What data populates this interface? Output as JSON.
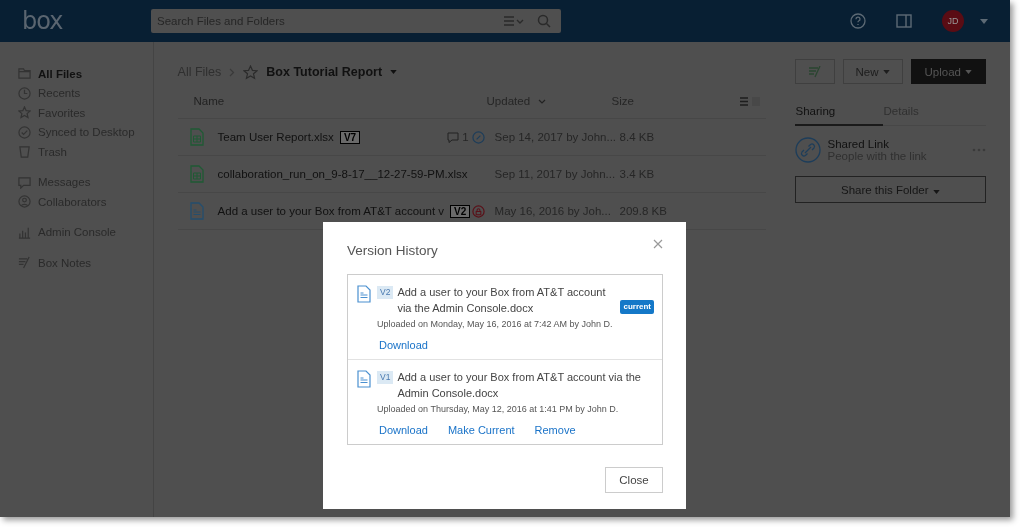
{
  "header": {
    "logo": "box",
    "search": {
      "placeholder": "Search Files and Folders"
    },
    "avatar": "JD"
  },
  "sidebar": {
    "groups": [
      [
        {
          "label": "All Files",
          "kind": "folder",
          "selected": true
        },
        {
          "label": "Recents",
          "kind": "clock",
          "selected": false
        },
        {
          "label": "Favorites",
          "kind": "star",
          "selected": false
        },
        {
          "label": "Synced to Desktop",
          "kind": "check",
          "selected": false
        },
        {
          "label": "Trash",
          "kind": "trash",
          "selected": false
        }
      ],
      [
        {
          "label": "Messages",
          "kind": "message",
          "selected": false
        },
        {
          "label": "Collaborators",
          "kind": "person",
          "selected": false
        }
      ],
      [
        {
          "label": "Admin Console",
          "kind": "chart",
          "selected": false
        }
      ],
      [
        {
          "label": "Box Notes",
          "kind": "notes",
          "selected": false
        }
      ]
    ]
  },
  "breadcrumb": {
    "root": "All Files",
    "current": "Box Tutorial Report"
  },
  "toolbar": {
    "buttons": [
      {
        "label": "New",
        "kind": "plain"
      },
      {
        "label": "Upload",
        "kind": "primary"
      }
    ]
  },
  "table": {
    "columns": [
      "Name",
      "Updated",
      "Size"
    ],
    "rows": [
      {
        "kind": "sheet",
        "name": "Team User Report.xlsx",
        "version": "V7",
        "comments": "1",
        "updated": "Sep 14, 2017 by John...",
        "size": "8.4 KB"
      },
      {
        "kind": "sheet",
        "name": "collaboration_run_on_9-8-17__12-27-59-PM.xlsx",
        "updated": "Sep 11, 2017 by John...",
        "size": "3.4 KB"
      },
      {
        "kind": "doc",
        "name": "Add a user to your Box from AT&T account v",
        "version": "V2",
        "updated": "May 16, 2016 by Joh...",
        "size": "209.8 KB"
      }
    ]
  },
  "side_panel": {
    "tabs": [
      {
        "label": "Sharing",
        "selected": true
      },
      {
        "label": "Details",
        "selected": false
      }
    ],
    "shared_link": {
      "title": "Shared Link",
      "subtitle": "People with the link"
    },
    "share_button": "Share this Folder"
  },
  "modal": {
    "title": "Version History",
    "versions": [
      {
        "badge": "V2",
        "name": "Add a user to your Box from AT&T account via the Admin Console.docx",
        "tag": "current",
        "uploaded": "Uploaded on Monday, May 16, 2016 at 7:42 AM by John D.",
        "actions": [
          "Download"
        ]
      },
      {
        "badge": "V1",
        "name": "Add a user to your Box from AT&T account via the Admin Console.docx",
        "uploaded": "Uploaded on Thursday, May 12, 2016 at 1:41 PM by John D.",
        "actions": [
          "Download",
          "Make Current",
          "Remove"
        ]
      }
    ],
    "close_button": "Close"
  }
}
